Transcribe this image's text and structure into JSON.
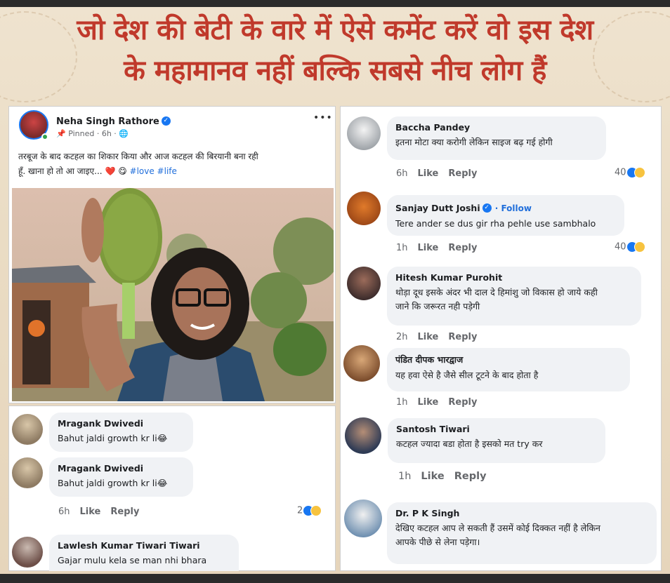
{
  "headline": {
    "line1": "जो देश की बेटी के वारे में ऐसे कमेंट करें वो इस देश",
    "line2": "के महामानव नहीं बल्कि सबसे नीच लोग हैं"
  },
  "post": {
    "author": "Neha Singh Rathore",
    "meta": "📌 Pinned · 6h · 🌐",
    "more_icon": "•••",
    "text_line1": "तरबूज के बाद कटहल का शिकार किया और आज कटहल की बिरयानी बना रही",
    "text_line2": "हूँ. खाना हो तो आ जाइए... ❤️ 😋 ",
    "hashtags": "#love #life"
  },
  "left_comments": [
    {
      "name": "Mragank Dwivedi",
      "text": "Bahut jaldi growth kr li😂"
    },
    {
      "name": "Mragank Dwivedi",
      "text": "Bahut jaldi growth kr li😂",
      "time": "6h",
      "like": "Like",
      "reply": "Reply",
      "reactions": "2"
    },
    {
      "name": "Lawlesh Kumar Tiwari Tiwari",
      "text": "Gajar  mulu kela  se man nhi bhara"
    }
  ],
  "right_comments": [
    {
      "name": "Baccha Pandey",
      "text": "इतना मोटा क्या करोगी लेकिन साइज बढ़ गई होगी",
      "time": "6h",
      "like": "Like",
      "reply": "Reply",
      "reactions": "40"
    },
    {
      "name": "Sanjay Dutt Joshi",
      "follow": "· Follow",
      "text": "Tere ander se dus gir rha pehle use sambhalo",
      "time": "1h",
      "like": "Like",
      "reply": "Reply",
      "reactions": "40"
    },
    {
      "name": "Hitesh Kumar Purohit",
      "text1": "थोड़ा दूध इसके अंदर भी दाल दे हिमांशु जो विकास हो जाये कही",
      "text2": "जाने कि जरूरत नही पड़ेगी",
      "time": "2h",
      "like": "Like",
      "reply": "Reply"
    },
    {
      "name": "पंडित दीपक भारद्वाज",
      "text": "यह हवा ऐसे है जैसे सील टूटने के बाद होता है",
      "time": "1h",
      "like": "Like",
      "reply": "Reply"
    },
    {
      "name": "Santosh Tiwari",
      "text": "कटहल ज्यादा बडा होता है इसको मत try कर",
      "time": "1h",
      "like": "Like",
      "reply": "Reply"
    },
    {
      "name": "Dr. P K Singh",
      "text1": "देखिए कटहल आप ले सकती हैं उसमें कोई दिक्कत नहीं है लेकिन",
      "text2": "आपके पीछे से लेना पड़ेगा।"
    }
  ],
  "colors": {
    "headline": "#c0392b",
    "link": "#216fdb",
    "bubble": "#f0f2f5"
  }
}
